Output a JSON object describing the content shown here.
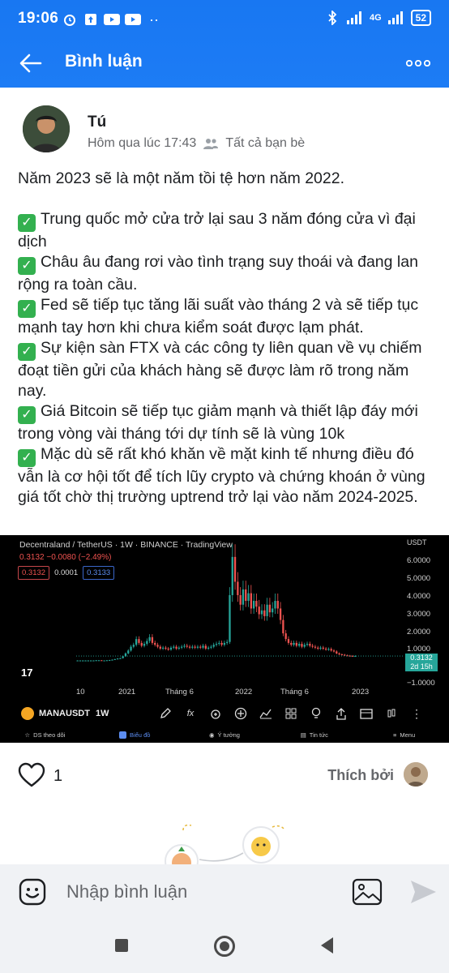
{
  "status_bar": {
    "time": "19:06",
    "network": "4G",
    "battery": "52",
    "left_icons": [
      "alarm-icon",
      "upload-icon",
      "youtube-icon",
      "youtube-icon",
      "more-dots-icon"
    ],
    "right_icons": [
      "bluetooth-icon",
      "signal-icon",
      "signal-icon",
      "wifi-icon",
      "battery-icon"
    ]
  },
  "header": {
    "title": "Bình luận",
    "back_icon": "arrow-left-icon",
    "more_icon": "more-horizontal-icon",
    "color": "#1877f2"
  },
  "post": {
    "author": "Tú",
    "time": "Hôm qua lúc 17:43",
    "audience": "Tất cả bạn bè",
    "intro": "Năm 2023 sẽ là một năm tồi tệ hơn năm 2022.",
    "points": [
      "Trung quốc mở cửa trở lại sau 3 năm đóng cửa vì đại dịch",
      "Châu âu đang rơi vào tình trạng suy thoái và đang lan rộng ra toàn cầu.",
      "Fed sẽ tiếp tục tăng lãi suất vào tháng 2 và sẽ tiếp tục mạnh tay hơn khi chưa kiểm soát được lạm phát.",
      "Sự kiện sàn FTX và các công ty liên quan về vụ chiếm đoạt tiền gửi của khách hàng sẽ được làm rõ trong năm nay.",
      "Giá Bitcoin sẽ tiếp tục giảm mạnh và thiết lập đáy mới trong vòng vài tháng tới dự tính sẽ là vùng 10k",
      "Mặc dù sẽ rất khó khăn về mặt kinh tế nhưng điều đó vẫn là cơ hội tốt để tích lũy crypto và chứng khoán ở vùng giá tốt chờ thị trường uptrend trở lại vào năm 2024-2025."
    ]
  },
  "chart": {
    "title": "Decentraland / TetherUS · 1W · BINANCE · TradingView",
    "price_change": "0.3132 −0.0080 (−2.49%)",
    "bid": "0.3132",
    "spread": "0.0001",
    "ask": "0.3133",
    "currency": "USDT",
    "current_price": "0.3132",
    "countdown": "2d 15h",
    "symbol": "MANAUSDT",
    "interval": "1W",
    "bottom_nav": [
      "DS theo dõi",
      "Biểu đồ",
      "Ý tưởng",
      "Tin tức",
      "Menu"
    ],
    "tools": [
      "pencil-icon",
      "fx-icon",
      "alarm-plus-icon",
      "plus-circle-icon",
      "chart-type-icon",
      "grid-icon",
      "lightbulb-icon",
      "share-icon",
      "calendar-icon",
      "candle-icon",
      "more-vertical-icon"
    ]
  },
  "chart_data": {
    "type": "candlestick",
    "title": "Decentraland / TetherUS · 1W · BINANCE · TradingView",
    "ylabel": "USDT",
    "y_ticks": [
      "6.0000",
      "5.0000",
      "4.0000",
      "3.0000",
      "2.0000",
      "1.0000",
      "0.3132",
      "−1.0000"
    ],
    "x_ticks": [
      "10",
      "2021",
      "Tháng 6",
      "2022",
      "Tháng 6",
      "2023"
    ],
    "ylim": [
      -1,
      6.3
    ],
    "closes": [
      0.08,
      0.08,
      0.08,
      0.08,
      0.08,
      0.08,
      0.08,
      0.09,
      0.09,
      0.08,
      0.08,
      0.09,
      0.1,
      0.12,
      0.15,
      0.18,
      0.2,
      0.3,
      0.45,
      0.6,
      0.8,
      0.9,
      1.2,
      1.0,
      0.85,
      0.95,
      1.1,
      1.3,
      1.0,
      0.9,
      0.8,
      0.7,
      0.75,
      0.7,
      0.65,
      0.75,
      0.8,
      0.7,
      0.75,
      0.8,
      0.85,
      0.8,
      0.75,
      0.8,
      0.75,
      0.8,
      0.75,
      0.85,
      0.7,
      0.75,
      0.8,
      0.9,
      0.95,
      1.0,
      0.9,
      1.0,
      1.05,
      3.5,
      5.5,
      4.2,
      3.5,
      3.0,
      3.8,
      3.2,
      3.6,
      2.8,
      3.2,
      2.9,
      2.5,
      2.7,
      2.4,
      3.0,
      2.6,
      2.8,
      3.2,
      2.8,
      2.2,
      1.5,
      1.2,
      1.0,
      0.9,
      1.0,
      0.85,
      0.95,
      0.8,
      0.9,
      0.95,
      0.85,
      0.8,
      0.75,
      0.7,
      0.75,
      0.7,
      0.65,
      0.68,
      0.6,
      0.55,
      0.45,
      0.4,
      0.38,
      0.35,
      0.33,
      0.32,
      0.31,
      0.3132
    ]
  },
  "reactions": {
    "like_count": "1",
    "liked_by_label": "Thích bởi"
  },
  "comment_bar": {
    "placeholder": "Nhập bình luận"
  }
}
